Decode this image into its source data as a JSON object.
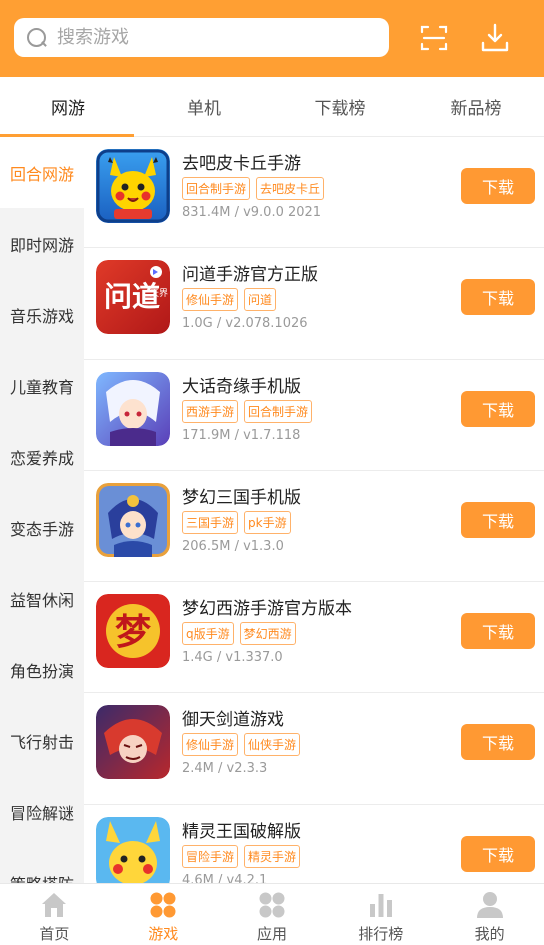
{
  "search": {
    "placeholder": "搜索游戏"
  },
  "tabs": [
    {
      "label": "网游"
    },
    {
      "label": "单机"
    },
    {
      "label": "下载榜"
    },
    {
      "label": "新品榜"
    }
  ],
  "categories": [
    {
      "label": "回合网游"
    },
    {
      "label": "即时网游"
    },
    {
      "label": "音乐游戏"
    },
    {
      "label": "儿童教育"
    },
    {
      "label": "恋爱养成"
    },
    {
      "label": "变态手游"
    },
    {
      "label": "益智休闲"
    },
    {
      "label": "角色扮演"
    },
    {
      "label": "飞行射击"
    },
    {
      "label": "冒险解谜"
    },
    {
      "label": "策略塔防"
    }
  ],
  "games": [
    {
      "name": "去吧皮卡丘手游",
      "tags": [
        "回合制手游",
        "去吧皮卡丘"
      ],
      "meta": "831.4M / v9.0.0 2021",
      "button": "下载",
      "icon": "pikachu-game-icon"
    },
    {
      "name": "问道手游官方正版",
      "tags": [
        "修仙手游",
        "问道"
      ],
      "meta": "1.0G / v2.078.1026",
      "button": "下载",
      "icon": "wendao-game-icon",
      "icon_text": "问道",
      "icon_subtext": "天界"
    },
    {
      "name": "大话奇缘手机版",
      "tags": [
        "西游手游",
        "回合制手游"
      ],
      "meta": "171.9M / v1.7.118",
      "button": "下载",
      "icon": "dahua-game-icon"
    },
    {
      "name": "梦幻三国手机版",
      "tags": [
        "三国手游",
        "pk手游"
      ],
      "meta": "206.5M / v1.3.0",
      "button": "下载",
      "icon": "sanguo-game-icon"
    },
    {
      "name": "梦幻西游手游官方版本",
      "tags": [
        "q版手游",
        "梦幻西游"
      ],
      "meta": "1.4G / v1.337.0",
      "button": "下载",
      "icon": "menghuan-game-icon",
      "icon_text": "梦"
    },
    {
      "name": "御天剑道游戏",
      "tags": [
        "修仙手游",
        "仙侠手游"
      ],
      "meta": "2.4M / v2.3.3",
      "button": "下载",
      "icon": "yutian-game-icon"
    },
    {
      "name": "精灵王国破解版",
      "tags": [
        "冒险手游",
        "精灵手游"
      ],
      "meta": "4.6M / v4.2.1",
      "button": "下载",
      "icon": "jingling-game-icon"
    }
  ],
  "bottom_nav": [
    {
      "label": "首页",
      "icon": "home-icon"
    },
    {
      "label": "游戏",
      "icon": "game-icon"
    },
    {
      "label": "应用",
      "icon": "apps-icon"
    },
    {
      "label": "排行榜",
      "icon": "ranking-icon"
    },
    {
      "label": "我的",
      "icon": "profile-icon"
    }
  ],
  "colors": {
    "accent": "#ff9f33",
    "active_text": "#ff8a1f",
    "tag_border": "#ffb26a"
  }
}
